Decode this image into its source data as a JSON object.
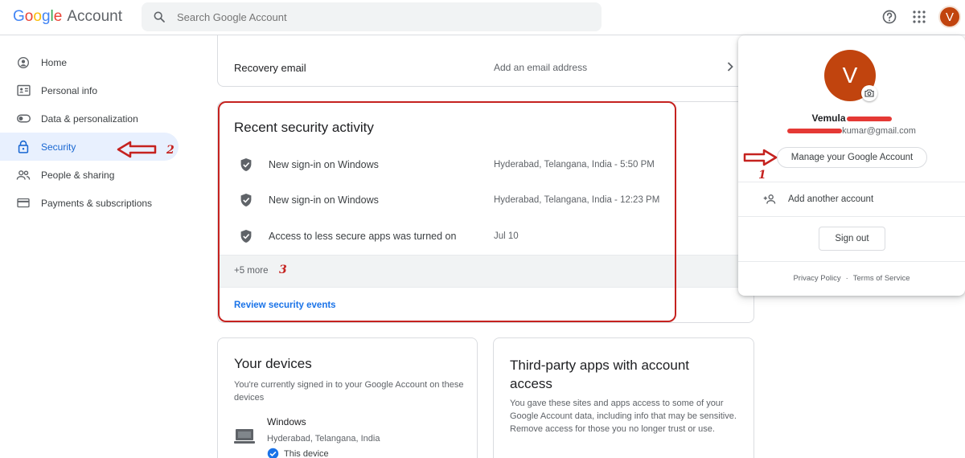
{
  "header": {
    "logo_letters": [
      "G",
      "o",
      "o",
      "g",
      "l",
      "e"
    ],
    "logo_product": "Account",
    "search_placeholder": "Search Google Account",
    "avatar_initial": "V"
  },
  "sidebar": {
    "items": [
      {
        "label": "Home",
        "icon": "home-icon"
      },
      {
        "label": "Personal info",
        "icon": "id-card-icon"
      },
      {
        "label": "Data & personalization",
        "icon": "toggle-icon"
      },
      {
        "label": "Security",
        "icon": "lock-icon"
      },
      {
        "label": "People & sharing",
        "icon": "people-icon"
      },
      {
        "label": "Payments & subscriptions",
        "icon": "credit-card-icon"
      }
    ],
    "active_index": 3
  },
  "recovery": {
    "label": "Recovery email",
    "value": "Add an email address"
  },
  "security_activity": {
    "title": "Recent security activity",
    "events": [
      {
        "text": "New sign-in on Windows",
        "meta": "Hyderabad, Telangana, India - 5:50 PM"
      },
      {
        "text": "New sign-in on Windows",
        "meta": "Hyderabad, Telangana, India - 12:23 PM"
      },
      {
        "text": "Access to less secure apps was turned on",
        "meta": "Jul 10"
      }
    ],
    "more": "+5 more",
    "review_link": "Review security events"
  },
  "devices": {
    "title": "Your devices",
    "description": "You're currently signed in to your Google Account on these devices",
    "device_name": "Windows",
    "device_location": "Hyderabad, Telangana, India",
    "device_tag": "This device"
  },
  "third_party": {
    "title": "Third-party apps with account access",
    "description": "You gave these sites and apps access to some of your Google Account data, including info that may be sensitive. Remove access for those you no longer trust or use."
  },
  "account_popup": {
    "avatar_initial": "V",
    "name": "Vemula",
    "email_suffix": "kumar@gmail.com",
    "manage_label": "Manage your Google Account",
    "add_account_label": "Add another account",
    "sign_out_label": "Sign out",
    "privacy_label": "Privacy Policy",
    "terms_label": "Terms of Service"
  },
  "annotations": {
    "num1": "1",
    "num2": "2",
    "num3": "3",
    "color": "#c5221f"
  },
  "colors": {
    "accent": "#1a73e8",
    "active_bg": "#e8f0fe",
    "avatar_bg": "#c1440e",
    "annotation_red": "#c5221f"
  }
}
